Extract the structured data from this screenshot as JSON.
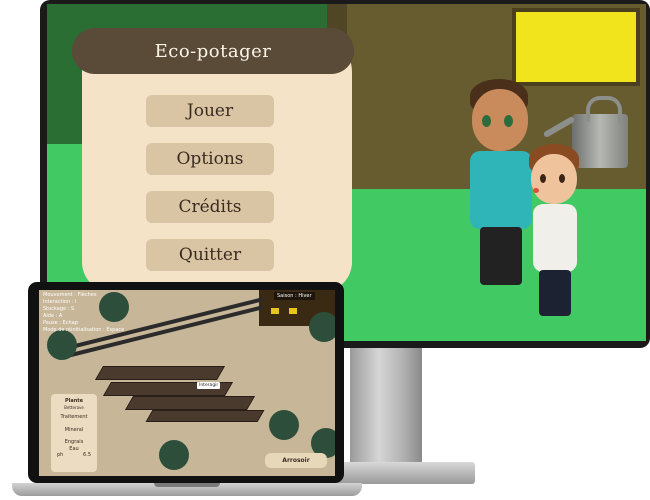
{
  "desktop": {
    "menu": {
      "title": "Eco-potager",
      "buttons": [
        {
          "label": "Jouer"
        },
        {
          "label": "Options"
        },
        {
          "label": "Crédits"
        },
        {
          "label": "Quitter"
        }
      ]
    }
  },
  "laptop": {
    "hud": {
      "lines": [
        "Mouvement : Flèches",
        "Interaction : I",
        "Stockage : S",
        "Aide : A",
        "Pause : Echap",
        "Mode de réinitialisation : Espace"
      ],
      "top_right": "Saison : Hiver"
    },
    "tag": "Interagir",
    "side_card": {
      "title": "Plante",
      "subtitle": "Betterave",
      "treatment": "Traitement",
      "mineral": "Mineral",
      "engrais": "Engrais",
      "eau": "Eau",
      "ph": "ph",
      "ph_value": "6.5"
    },
    "tool_button": "Arrosoir"
  },
  "colors": {
    "grass": "#41c964",
    "menu_header": "#5a4a38",
    "menu_panel": "#f5e3c8",
    "menu_button": "#d9c4a4",
    "window": "#f1e31c"
  }
}
